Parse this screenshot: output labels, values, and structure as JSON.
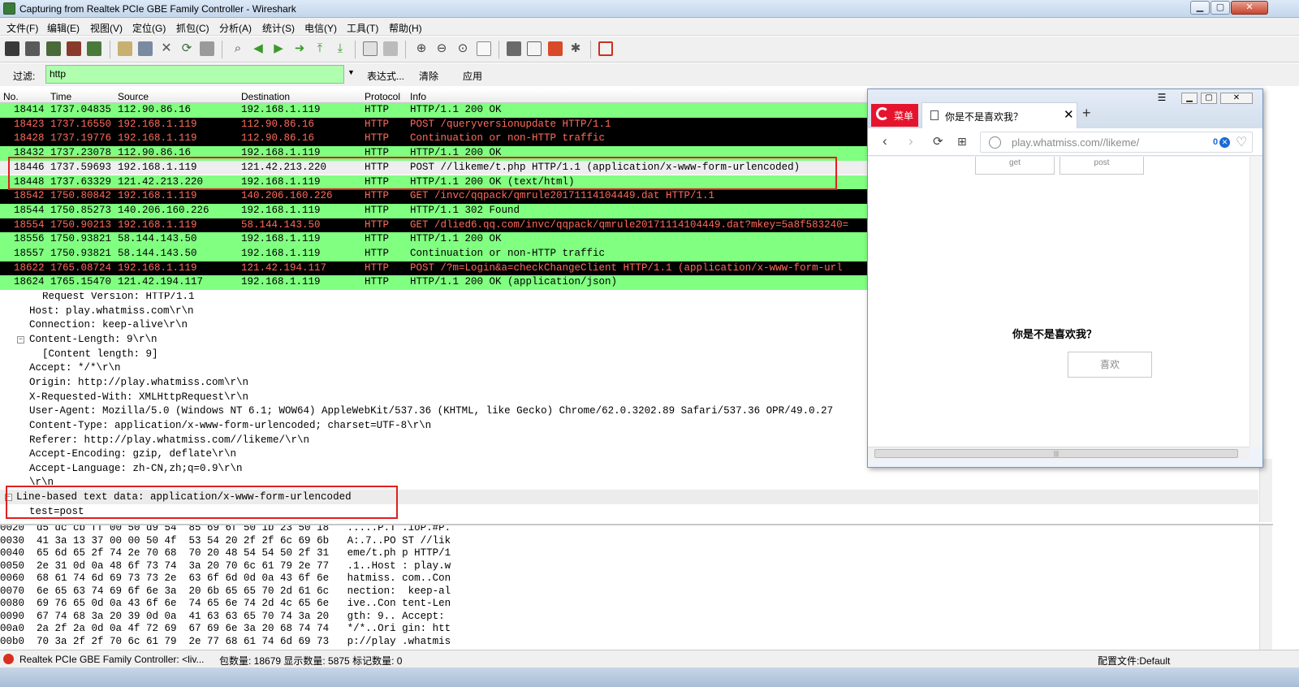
{
  "window": {
    "title": "Capturing from Realtek PCIe GBE Family Controller - Wireshark"
  },
  "menu": [
    "文件(F)",
    "编辑(E)",
    "视图(V)",
    "定位(G)",
    "抓包(C)",
    "分析(A)",
    "统计(S)",
    "电信(Y)",
    "工具(T)",
    "帮助(H)"
  ],
  "filter": {
    "label": "过滤:",
    "value": "http",
    "expression": "表达式...",
    "clear": "清除",
    "apply": "应用"
  },
  "columns": [
    "No.",
    "Time",
    "Source",
    "Destination",
    "Protocol",
    "Info"
  ],
  "packets": [
    {
      "no": "18414",
      "time": "1737.04835",
      "src": "112.90.86.16",
      "dst": "192.168.1.119",
      "proto": "HTTP",
      "info": "HTTP/1.1 200 OK",
      "style": "green"
    },
    {
      "no": "18423",
      "time": "1737.16550",
      "src": "192.168.1.119",
      "dst": "112.90.86.16",
      "proto": "HTTP",
      "info": "POST /queryversionupdate HTTP/1.1",
      "style": "black"
    },
    {
      "no": "18428",
      "time": "1737.19776",
      "src": "192.168.1.119",
      "dst": "112.90.86.16",
      "proto": "HTTP",
      "info": "Continuation or non-HTTP traffic",
      "style": "black"
    },
    {
      "no": "18432",
      "time": "1737.23078",
      "src": "112.90.86.16",
      "dst": "192.168.1.119",
      "proto": "HTTP",
      "info": "HTTP/1.1 200 OK",
      "style": "green"
    },
    {
      "no": "18446",
      "time": "1737.59693",
      "src": "192.168.1.119",
      "dst": "121.42.213.220",
      "proto": "HTTP",
      "info": "POST //likeme/t.php HTTP/1.1  (application/x-www-form-urlencoded)",
      "style": "sel"
    },
    {
      "no": "18448",
      "time": "1737.63329",
      "src": "121.42.213.220",
      "dst": "192.168.1.119",
      "proto": "HTTP",
      "info": "HTTP/1.1 200 OK  (text/html)",
      "style": "green"
    },
    {
      "no": "18542",
      "time": "1750.80842",
      "src": "192.168.1.119",
      "dst": "140.206.160.226",
      "proto": "HTTP",
      "info": "GET /invc/qqpack/qmrule20171114104449.dat HTTP/1.1",
      "style": "black"
    },
    {
      "no": "18544",
      "time": "1750.85273",
      "src": "140.206.160.226",
      "dst": "192.168.1.119",
      "proto": "HTTP",
      "info": "HTTP/1.1 302 Found",
      "style": "green"
    },
    {
      "no": "18554",
      "time": "1750.90213",
      "src": "192.168.1.119",
      "dst": "58.144.143.50",
      "proto": "HTTP",
      "info": "GET /dlied6.qq.com/invc/qqpack/qmrule20171114104449.dat?mkey=5a8f583240=",
      "style": "black"
    },
    {
      "no": "18556",
      "time": "1750.93821",
      "src": "58.144.143.50",
      "dst": "192.168.1.119",
      "proto": "HTTP",
      "info": "HTTP/1.1 200 OK",
      "style": "green"
    },
    {
      "no": "18557",
      "time": "1750.93821",
      "src": "58.144.143.50",
      "dst": "192.168.1.119",
      "proto": "HTTP",
      "info": "Continuation or non-HTTP traffic",
      "style": "green"
    },
    {
      "no": "18622",
      "time": "1765.08724",
      "src": "192.168.1.119",
      "dst": "121.42.194.117",
      "proto": "HTTP",
      "info": "POST /?m=Login&a=checkChangeClient HTTP/1.1  (application/x-www-form-url",
      "style": "black"
    },
    {
      "no": "18624",
      "time": "1765.15470",
      "src": "121.42.194.117",
      "dst": "192.168.1.119",
      "proto": "HTTP",
      "info": "HTTP/1.1 200 OK  (application/json)",
      "style": "green"
    }
  ],
  "details": {
    "request_version": "Request Version: HTTP/1.1",
    "host": "Host: play.whatmiss.com\\r\\n",
    "connection": "Connection: keep-alive\\r\\n",
    "content_length": "Content-Length: 9\\r\\n",
    "content_length_sub": "[Content length: 9]",
    "accept": "Accept: */*\\r\\n",
    "origin": "Origin: http://play.whatmiss.com\\r\\n",
    "x_requested_with": "X-Requested-With: XMLHttpRequest\\r\\n",
    "user_agent": "User-Agent: Mozilla/5.0 (Windows NT 6.1; WOW64) AppleWebKit/537.36 (KHTML, like Gecko) Chrome/62.0.3202.89 Safari/537.36 OPR/49.0.27",
    "content_type": "Content-Type: application/x-www-form-urlencoded; charset=UTF-8\\r\\n",
    "referer": "Referer: http://play.whatmiss.com//likeme/\\r\\n",
    "accept_encoding": "Accept-Encoding: gzip, deflate\\r\\n",
    "accept_language": "Accept-Language: zh-CN,zh;q=0.9\\r\\n",
    "crlf": "\\r\\n",
    "line_based": "Line-based text data: application/x-www-form-urlencoded",
    "body": "test=post"
  },
  "hex": [
    "0020  d5 dc cb ff 00 50 d9 54  85 69 6f 50 1b 23 50 18   .....P.T .ioP.#P.",
    "0030  41 3a 13 37 00 00 50 4f  53 54 20 2f 2f 6c 69 6b   A:.7..PO ST //lik",
    "0040  65 6d 65 2f 74 2e 70 68  70 20 48 54 54 50 2f 31   eme/t.ph p HTTP/1",
    "0050  2e 31 0d 0a 48 6f 73 74  3a 20 70 6c 61 79 2e 77   .1..Host : play.w",
    "0060  68 61 74 6d 69 73 73 2e  63 6f 6d 0d 0a 43 6f 6e   hatmiss. com..Con",
    "0070  6e 65 63 74 69 6f 6e 3a  20 6b 65 65 70 2d 61 6c   nection:  keep-al",
    "0080  69 76 65 0d 0a 43 6f 6e  74 65 6e 74 2d 4c 65 6e   ive..Con tent-Len",
    "0090  67 74 68 3a 20 39 0d 0a  41 63 63 65 70 74 3a 20   gth: 9.. Accept: ",
    "00a0  2a 2f 2a 0d 0a 4f 72 69  67 69 6e 3a 20 68 74 74   */*..Ori gin: htt",
    "00b0  70 3a 2f 2f 70 6c 61 79  2e 77 68 61 74 6d 69 73   p://play .whatmis"
  ],
  "status": {
    "interface": "Realtek PCIe GBE Family Controller: <liv...",
    "counts": "包数量: 18679 显示数量: 5875 标记数量: 0",
    "profile": "配置文件:Default"
  },
  "browser": {
    "menu": "菜单",
    "tab_title": "你是不是喜欢我？",
    "url": "play.whatmiss.com//likeme/",
    "adblock_count": "0",
    "btn_get": "get",
    "btn_post": "post",
    "question": "你是不是喜欢我？",
    "like": "喜欢"
  },
  "colors": {
    "green_row": "#80ff80",
    "black_row": "#000000",
    "black_row_text": "#ff6a5a",
    "highlight_box": "#e02020",
    "filter_bg": "#afffaf",
    "opera_red": "#e5142c"
  }
}
